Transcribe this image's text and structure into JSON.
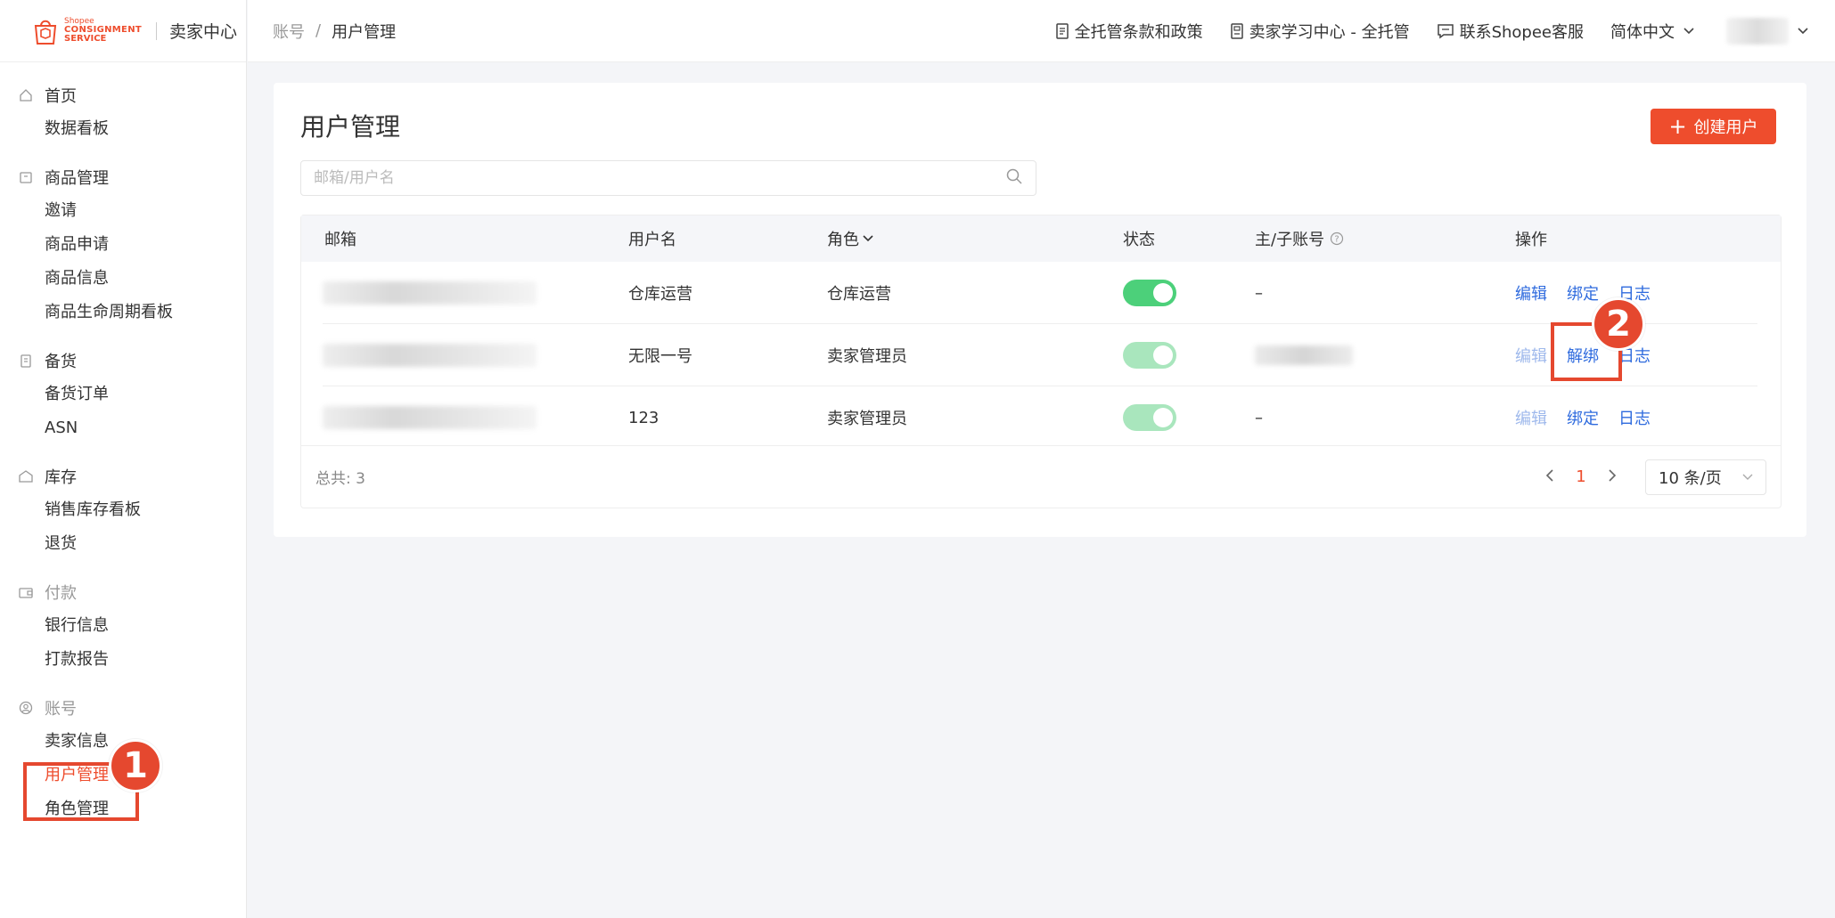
{
  "brand": {
    "logo_line1": "Shopee",
    "logo_line2": "CONSIGNMENT",
    "logo_line3": "SERVICE",
    "title": "卖家中心",
    "accent": "#ee4d2d"
  },
  "breadcrumb": {
    "parent": "账号",
    "separator": "/",
    "current": "用户管理"
  },
  "header_links": [
    {
      "label": "全托管条款和政策",
      "icon": "document-icon"
    },
    {
      "label": "卖家学习中心 - 全托管",
      "icon": "book-icon"
    },
    {
      "label": "联系Shopee客服",
      "icon": "chat-icon"
    }
  ],
  "language": "简体中文",
  "sidebar": {
    "groups": [
      {
        "label": "首页",
        "icon": "home-icon",
        "items": [
          "数据看板"
        ]
      },
      {
        "label": "商品管理",
        "icon": "box-icon",
        "items": [
          "邀请",
          "商品申请",
          "商品信息",
          "商品生命周期看板"
        ]
      },
      {
        "label": "备货",
        "icon": "clipboard-icon",
        "items": [
          "备货订单",
          "ASN"
        ]
      },
      {
        "label": "库存",
        "icon": "warehouse-icon",
        "items": [
          "销售库存看板",
          "退货"
        ]
      },
      {
        "label": "付款",
        "icon": "wallet-icon",
        "items": [
          "银行信息",
          "打款报告"
        ]
      },
      {
        "label": "账号",
        "icon": "user-circle-icon",
        "items": [
          "卖家信息",
          "用户管理",
          "角色管理"
        ]
      }
    ],
    "active_item": "用户管理"
  },
  "page": {
    "title": "用户管理",
    "create_button": "创建用户",
    "search_placeholder": "邮箱/用户名"
  },
  "table": {
    "columns": [
      "邮箱",
      "用户名",
      "角色",
      "状态",
      "主/子账号",
      "操作"
    ],
    "rows": [
      {
        "username": "仓库运营",
        "role": "仓库运营",
        "status_on": true,
        "status_disabled": false,
        "account": "–",
        "ops": [
          "编辑",
          "绑定",
          "日志"
        ],
        "edit_disabled": false
      },
      {
        "username": "无限一号",
        "role": "卖家管理员",
        "status_on": true,
        "status_disabled": true,
        "account": "",
        "ops": [
          "编辑",
          "解绑",
          "日志"
        ],
        "edit_disabled": true
      },
      {
        "username": "123",
        "role": "卖家管理员",
        "status_on": true,
        "status_disabled": true,
        "account": "–",
        "ops": [
          "编辑",
          "绑定",
          "日志"
        ],
        "edit_disabled": true
      }
    ]
  },
  "footer": {
    "total": "总共: 3",
    "current_page": "1",
    "page_size": "10 条/页"
  },
  "annotations": {
    "step1": "1",
    "step2": "2",
    "color": "#e5482f"
  },
  "colors": {
    "toggle_on": "#4cd07a",
    "toggle_on_disabled": "#a9e6bd",
    "link": "#2f6bde",
    "link_disabled": "#9fb9ec"
  }
}
